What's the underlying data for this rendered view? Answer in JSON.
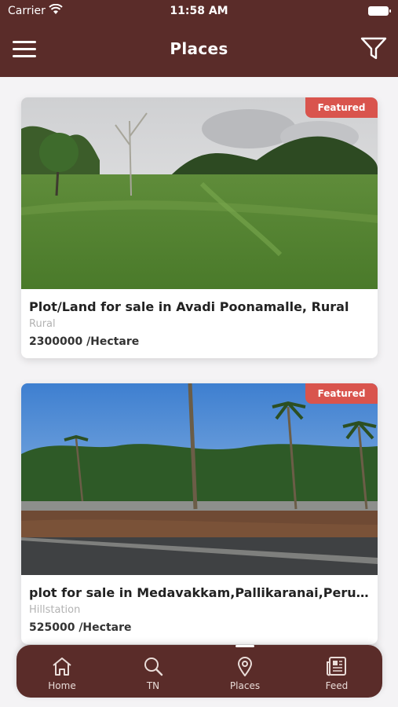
{
  "status_bar": {
    "carrier": "Carrier",
    "time": "11:58 AM"
  },
  "header": {
    "title": "Places",
    "menu_icon": "hamburger-menu-icon",
    "filter_icon": "filter-funnel-icon"
  },
  "listings": [
    {
      "badge": "Featured",
      "title": "Plot/Land for sale in Avadi Poonamalle, Rural",
      "category": "Rural",
      "price": "2300000 /Hectare"
    },
    {
      "badge": "Featured",
      "title": "plot for sale in Medavakkam,Pallikaranai,Perumbakkam",
      "category": "Hillstation",
      "price": "525000 /Hectare"
    }
  ],
  "tabs": [
    {
      "label": "Home",
      "icon": "home-icon"
    },
    {
      "label": "TN",
      "icon": "search-icon"
    },
    {
      "label": "Places",
      "icon": "location-pin-icon",
      "active": true
    },
    {
      "label": "Feed",
      "icon": "newspaper-icon"
    }
  ],
  "colors": {
    "primary": "#5a2c29",
    "badge": "#d9544d",
    "background": "#f4f3f5"
  }
}
